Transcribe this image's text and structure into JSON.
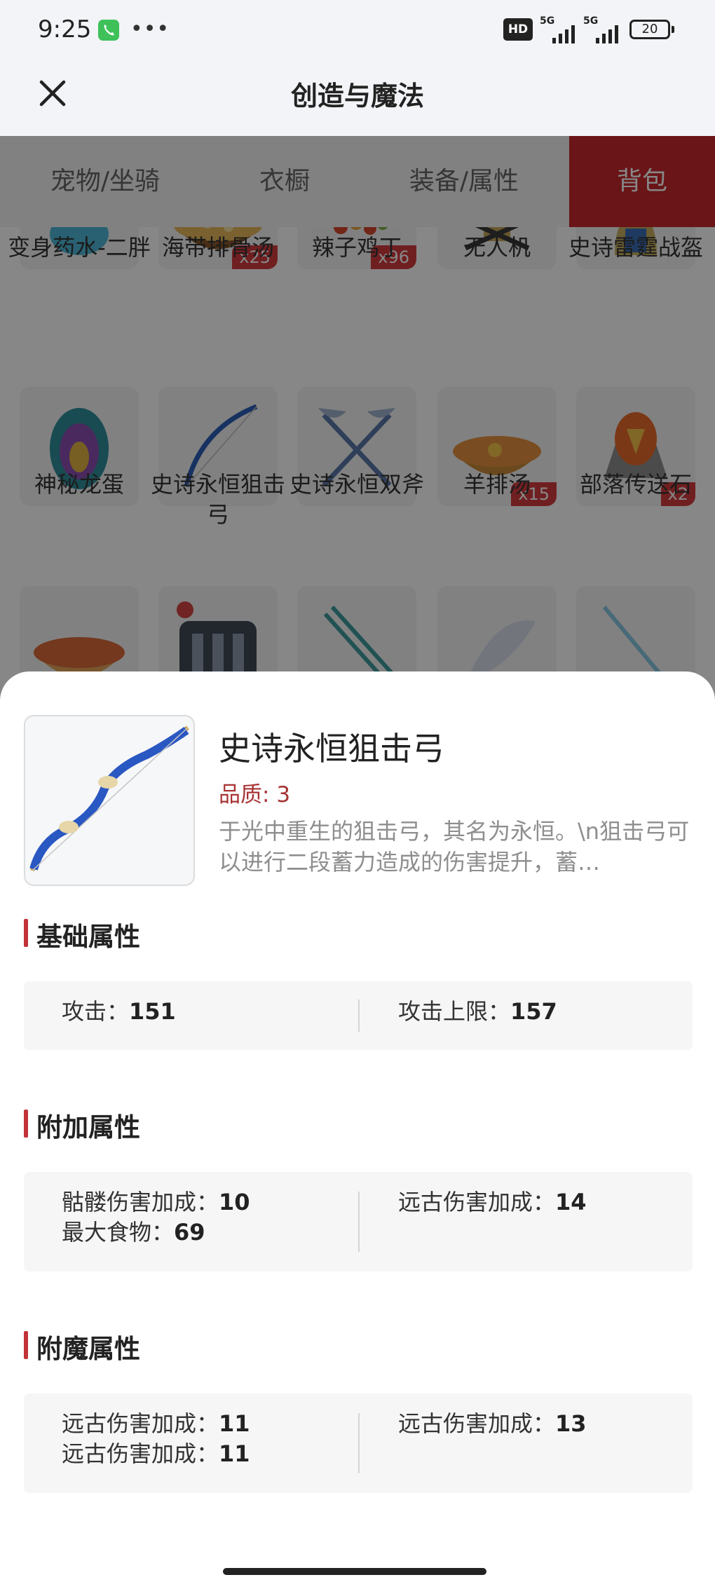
{
  "status": {
    "time": "9:25",
    "more": "•••",
    "hd": "HD",
    "sig1": "5G",
    "sig2": "5G",
    "battery": "20"
  },
  "nav": {
    "title": "创造与魔法"
  },
  "tabs": [
    "宠物/坐骑",
    "衣橱",
    "装备/属性",
    "背包"
  ],
  "grid": {
    "row1": [
      {
        "name": "变身药水-二胖",
        "qty": ""
      },
      {
        "name": "海带排骨汤",
        "qty": "x25"
      },
      {
        "name": "辣子鸡丁",
        "qty": "x96"
      },
      {
        "name": "无人机",
        "qty": ""
      },
      {
        "name": "史诗雷霆战盔",
        "qty": ""
      }
    ],
    "row2": [
      {
        "name": "神秘龙蛋",
        "qty": ""
      },
      {
        "name": "史诗永恒狙击弓",
        "qty": ""
      },
      {
        "name": "史诗永恒双斧",
        "qty": ""
      },
      {
        "name": "羊排汤",
        "qty": "x15"
      },
      {
        "name": "部落传送石",
        "qty": "x2"
      }
    ]
  },
  "detail": {
    "name": "史诗永恒狙击弓",
    "quality_label": "品质: ",
    "quality_value": "3",
    "description": "于光中重生的狙击弓，其名为永恒。\\n狙击弓可以进行二段蓄力造成的伤害提升，蓄…"
  },
  "sections": {
    "basic": {
      "title": "基础属性",
      "left": [
        {
          "label": "攻击：",
          "value": "151"
        }
      ],
      "right": [
        {
          "label": "攻击上限：",
          "value": "157"
        }
      ]
    },
    "extra": {
      "title": "附加属性",
      "left": [
        {
          "label": "骷髅伤害加成：",
          "value": "10"
        },
        {
          "label": "最大食物：",
          "value": "69"
        }
      ],
      "right": [
        {
          "label": "远古伤害加成：",
          "value": "14"
        }
      ]
    },
    "enchant": {
      "title": "附魔属性",
      "left": [
        {
          "label": "远古伤害加成：",
          "value": "11"
        },
        {
          "label": "远古伤害加成：",
          "value": "11"
        }
      ],
      "right": [
        {
          "label": "远古伤害加成：",
          "value": "13"
        }
      ]
    }
  },
  "colors": {
    "accent": "#c8282d",
    "section_bar": "#c23338",
    "quality": "#a83434"
  }
}
